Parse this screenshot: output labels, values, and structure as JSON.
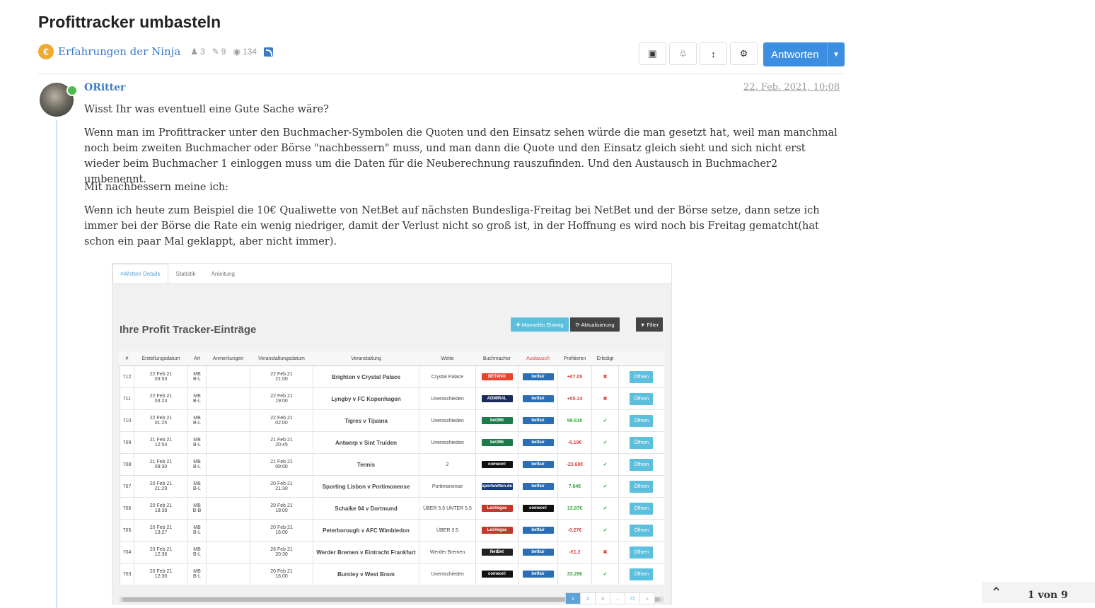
{
  "topic": {
    "title": "Profittracker umbasteln",
    "category": "Erfahrungen der Ninja",
    "category_icon": "€",
    "posters": "3",
    "posts": "9",
    "views": "134"
  },
  "toolbar": {
    "reply_label": "Antworten"
  },
  "post": {
    "author": "ORitter",
    "timestamp": "22. Feb. 2021, 10:08",
    "paragraphs": [
      "Wisst Ihr was eventuell eine Gute Sache wäre?",
      "Wenn man im Profittracker unter den Buchmacher-Symbolen die Quoten und den Einsatz sehen würde die man gesetzt hat, weil man manchmal noch beim zweiten Buchmacher oder Börse \"nachbessern\" muss, und man dann die Quote und den Einsatz gleich sieht und sich nicht erst wieder beim Buchmacher 1 einloggen muss um die Daten für die Neuberechnung rauszufinden. Und den Austausch in Buchmacher2 umbenennt.",
      "Mit nachbessern meine ich:",
      "Wenn ich heute zum Beispiel die 10€ Qualiwette von NetBet auf nächsten Bundesliga-Freitag bei NetBet und der Börse setze, dann setze ich immer bei der Börse die Rate ein wenig niedriger, damit der Verlust nicht so groß ist, in der Hoffnung es wird noch bis Freitag gematcht(hat schon ein paar Mal geklappt, aber nicht immer)."
    ]
  },
  "screenshot": {
    "tabs": [
      "≡Wetten Details",
      "Statistik",
      "Anleitung"
    ],
    "heading": "Ihre Profit Tracker-Einträge",
    "btn_manual": "✚ Manueller Eintrag",
    "btn_refresh": "⟳ Aktualisierung",
    "btn_filter": "▼ Filter",
    "columns": [
      "#",
      "Erstellungsdatum",
      "Art",
      "Anmerkungen",
      "Veranstaltungsdatum",
      "Veranstaltung",
      "Wette",
      "Buchmacher",
      "Austausch",
      "Profitieren",
      "Erledigt",
      ""
    ],
    "rows": [
      {
        "id": "712",
        "created": "22 Feb 21\n03:53",
        "art": "MB\nB-L",
        "event_date": "22 Feb 21\n21:00",
        "event": "Brighton v Crystal Palace",
        "bet": "Crystal Palace",
        "bookie": "BETANO",
        "bookie_color": "#e8432e",
        "exchange": "betfair",
        "profit": "+€7.05",
        "profit_sign": "neg",
        "done": "cross",
        "open": "Öffnen"
      },
      {
        "id": "711",
        "created": "22 Feb 21\n03:23",
        "art": "MB\nB-L",
        "event_date": "22 Feb 21\n19:00",
        "event": "Lyngby v FC Kopenhagen",
        "bet": "Unentschieden",
        "bookie": "ADMIRAL",
        "bookie_color": "#1c2a5a",
        "exchange": "betfair",
        "profit": "+€5.14",
        "profit_sign": "neg",
        "done": "cross",
        "open": "Öffnen"
      },
      {
        "id": "710",
        "created": "22 Feb 21\n01:25",
        "art": "MB\nB-L",
        "event_date": "22 Feb 21\n02:00",
        "event": "Tigres v Tijuana",
        "bet": "Unentschieden",
        "bookie": "bet365",
        "bookie_color": "#1d7a4b",
        "exchange": "betfair",
        "profit": "99.61€",
        "profit_sign": "pos",
        "done": "check",
        "open": "Öffnen"
      },
      {
        "id": "709",
        "created": "21 Feb 21\n12:54",
        "art": "MB\nB-L",
        "event_date": "21 Feb 21\n20:45",
        "event": "Antwerp v Sint Truiden",
        "bet": "Unentschieden",
        "bookie": "bet365",
        "bookie_color": "#1d7a4b",
        "exchange": "betfair",
        "profit": "-6.19€",
        "profit_sign": "neg",
        "done": "check",
        "open": "Öffnen"
      },
      {
        "id": "708",
        "created": "21 Feb 21\n09:30",
        "art": "MB\nB-L",
        "event_date": "21 Feb 21\n09:00",
        "event": "Tennis",
        "bet": "2",
        "bookie": "comeon!",
        "bookie_color": "#111111",
        "exchange": "betfair",
        "profit": "-23.69€",
        "profit_sign": "neg",
        "done": "check",
        "open": "Öffnen"
      },
      {
        "id": "707",
        "created": "20 Feb 21\n21:29",
        "art": "MB\nB-L",
        "event_date": "20 Feb 21\n21:30",
        "event": "Sporting Lisbon v Portimonense",
        "bet": "Portimonense",
        "bookie": "sportwetten.de",
        "bookie_color": "#1b3c7a",
        "exchange": "betfair",
        "profit": "7.84€",
        "profit_sign": "pos",
        "done": "check",
        "open": "Öffnen"
      },
      {
        "id": "706",
        "created": "20 Feb 21\n18:38",
        "art": "MB\nB-B",
        "event_date": "20 Feb 21\n18:00",
        "event": "Schalke 04 v Dortmund",
        "bet": "ÜBER 5.5 UNTER 5.5",
        "bookie": "LeoVegas",
        "bookie_color": "#c0392b",
        "exchange": "comeon!",
        "profit": "13.97€",
        "profit_sign": "pos",
        "done": "check",
        "open": "Öffnen"
      },
      {
        "id": "705",
        "created": "20 Feb 21\n13:27",
        "art": "MB\nB-L",
        "event_date": "20 Feb 21\n16:00",
        "event": "Peterborough v AFC Wimbledon",
        "bet": "ÜBER 3.5",
        "bookie": "LeoVegas",
        "bookie_color": "#c0392b",
        "exchange": "betfair",
        "profit": "-0.27€",
        "profit_sign": "neg",
        "done": "check",
        "open": "Öffnen"
      },
      {
        "id": "704",
        "created": "20 Feb 21\n12:36",
        "art": "MB\nB-L",
        "event_date": "26 Feb 21\n20:30",
        "event": "Werder Bremen v Eintracht Frankfurt",
        "bet": "Werder Bremen",
        "bookie": "NetBet",
        "bookie_color": "#222222",
        "exchange": "betfair",
        "profit": "-€1.2",
        "profit_sign": "neg",
        "done": "cross",
        "open": "Öffnen"
      },
      {
        "id": "703",
        "created": "20 Feb 21\n12:30",
        "art": "MB\nB-L",
        "event_date": "20 Feb 21\n16:00",
        "event": "Burnley v West Brom",
        "bet": "Unentschieden",
        "bookie": "comeon!",
        "bookie_color": "#111111",
        "exchange": "betfair",
        "profit": "33.29€",
        "profit_sign": "pos",
        "done": "check",
        "open": "Öffnen"
      }
    ],
    "pager": [
      "1",
      "2",
      "3",
      "...",
      "72",
      "»"
    ]
  },
  "pagination": {
    "text": "1 von 9"
  },
  "colors": {
    "accent": "#3c8ee0",
    "link": "#3a7bc8",
    "online": "#4cbb4c"
  }
}
